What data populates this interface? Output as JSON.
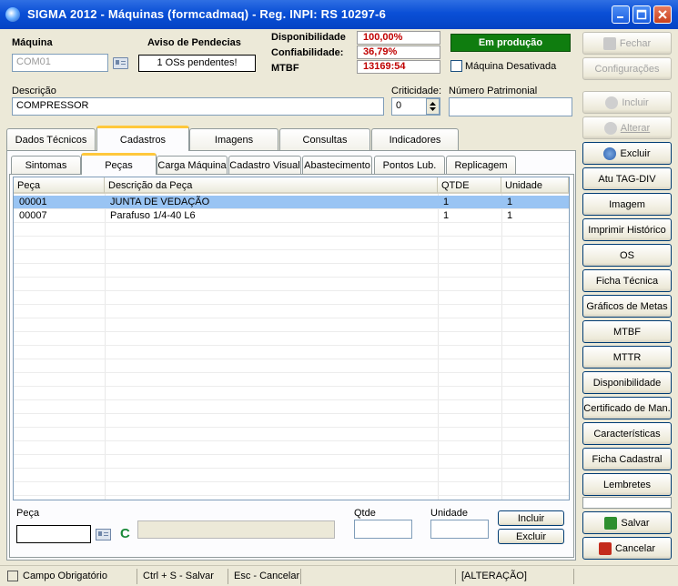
{
  "window": {
    "title": "SIGMA 2012 - Máquinas  (formcadmaq)  - Reg. INPI: RS 10297-6"
  },
  "header": {
    "maquina_label": "Máquina",
    "maquina_value": "COM01",
    "aviso_label": "Aviso de Pendecias",
    "aviso_value": "1  OSs pendentes!",
    "disponibilidade_label": "Disponibilidade",
    "disponibilidade_value": "100,00%",
    "confiabilidade_label": "Confiabilidade:",
    "confiabilidade_value": "36,79%",
    "mtbf_label": "MTBF",
    "mtbf_value": "13169:54",
    "status_label": "Em produção",
    "desativada_label": "Máquina Desativada",
    "descricao_label": "Descrição",
    "descricao_value": "COMPRESSOR",
    "criticidade_label": "Criticidade:",
    "criticidade_value": "0",
    "patrimonial_label": "Número Patrimonial",
    "patrimonial_value": ""
  },
  "main_tabs": [
    "Dados Técnicos",
    "Cadastros",
    "Imagens",
    "Consultas",
    "Indicadores"
  ],
  "sub_tabs": [
    "Sintomas",
    "Peças",
    "Carga Máquina",
    "Cadastro Visual",
    "Abastecimento",
    "Pontos Lub.",
    "Replicagem"
  ],
  "grid": {
    "columns": [
      "Peça",
      "Descrição da Peça",
      "QTDE",
      "Unidade"
    ],
    "rows": [
      {
        "peca": "00001",
        "descricao": "JUNTA DE VEDAÇÃO",
        "qtde": "1",
        "unidade": "1"
      },
      {
        "peca": "00007",
        "descricao": "Parafuso 1/4-40 L6",
        "qtde": "1",
        "unidade": "1"
      }
    ]
  },
  "bottom_form": {
    "peca_label": "Peça",
    "peca_value": "",
    "c_label": "C",
    "qtde_label": "Qtde",
    "unidade_label": "Unidade",
    "incluir_label": "Incluir",
    "excluir_label": "Excluir"
  },
  "side_buttons": {
    "fechar": "Fechar",
    "configuracoes": "Configurações",
    "incluir": "Incluir",
    "alterar": "Alterar",
    "excluir": "Excluir",
    "atu_tag_div": "Atu TAG-DIV",
    "imagem": "Imagem",
    "imprimir_historico": "Imprimir Histórico",
    "os": "OS",
    "ficha_tecnica": "Ficha Técnica",
    "graficos_metas": "Gráficos de Metas",
    "mtbf": "MTBF",
    "mttr": "MTTR",
    "disponibilidade": "Disponibilidade",
    "certificado": "Certificado de Man.",
    "caracteristicas": "Características",
    "ficha_cadastral": "Ficha Cadastral",
    "lembretes": "Lembretes",
    "salvar": "Salvar",
    "cancelar": "Cancelar"
  },
  "statusbar": {
    "campo": "Campo Obrigatório",
    "ctrl_s": "Ctrl + S - Salvar",
    "esc": "Esc - Cancelar",
    "mode": "[ALTERAÇÃO]"
  },
  "colors": {
    "titlebar": "#0a4fd6",
    "status_green": "#0f7d0f",
    "stat_red": "#c00000",
    "selection": "#99c4f3",
    "tab_highlight": "#ffc83c"
  }
}
